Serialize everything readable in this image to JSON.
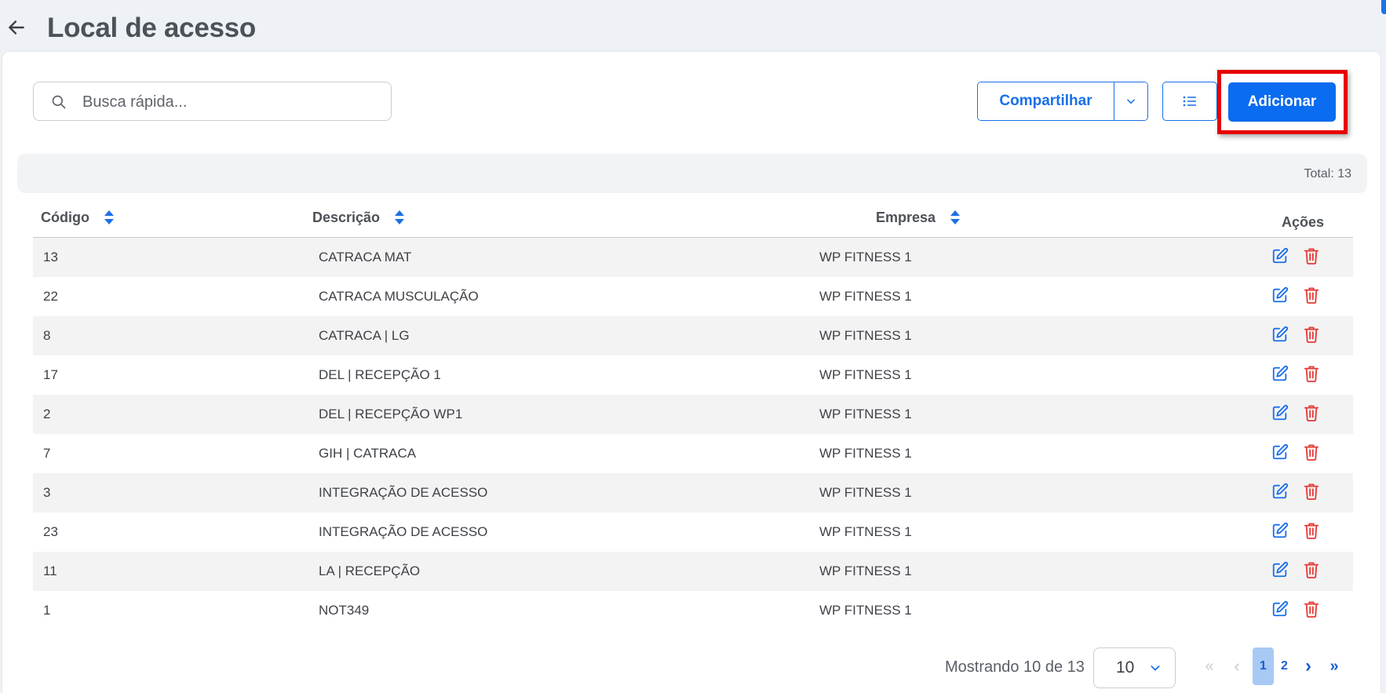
{
  "header": {
    "title": "Local de acesso"
  },
  "search": {
    "placeholder": "Busca rápida..."
  },
  "toolbar": {
    "share_label": "Compartilhar",
    "add_label": "Adicionar"
  },
  "total": "Total: 13",
  "table": {
    "columns": [
      "Código",
      "Descrição",
      "Empresa",
      "Ações"
    ],
    "rows": [
      {
        "codigo": "13",
        "descricao": "CATRACA MAT",
        "empresa": "WP FITNESS 1"
      },
      {
        "codigo": "22",
        "descricao": "CATRACA MUSCULAÇÃO",
        "empresa": "WP FITNESS 1"
      },
      {
        "codigo": "8",
        "descricao": "CATRACA | LG",
        "empresa": "WP FITNESS 1"
      },
      {
        "codigo": "17",
        "descricao": "DEL | RECEPÇÃO 1",
        "empresa": "WP FITNESS 1"
      },
      {
        "codigo": "2",
        "descricao": "DEL | RECEPÇÃO WP1",
        "empresa": "WP FITNESS 1"
      },
      {
        "codigo": "7",
        "descricao": "GIH | CATRACA",
        "empresa": "WP FITNESS 1"
      },
      {
        "codigo": "3",
        "descricao": "INTEGRAÇÃO DE ACESSO",
        "empresa": "WP FITNESS 1"
      },
      {
        "codigo": "23",
        "descricao": "INTEGRAÇÃO DE ACESSO",
        "empresa": "WP FITNESS 1"
      },
      {
        "codigo": "11",
        "descricao": "LA | RECEPÇÃO",
        "empresa": "WP FITNESS 1"
      },
      {
        "codigo": "1",
        "descricao": "NOT349",
        "empresa": "WP FITNESS 1"
      }
    ]
  },
  "pagination": {
    "info": "Mostrando 10 de 13",
    "page_size": "10",
    "pages": [
      "1",
      "2"
    ],
    "first": "«",
    "prev": "‹",
    "next": "›",
    "last": "»"
  },
  "colors": {
    "accent": "#0a6cf0",
    "danger": "#e53935",
    "highlight": "#e60000"
  }
}
